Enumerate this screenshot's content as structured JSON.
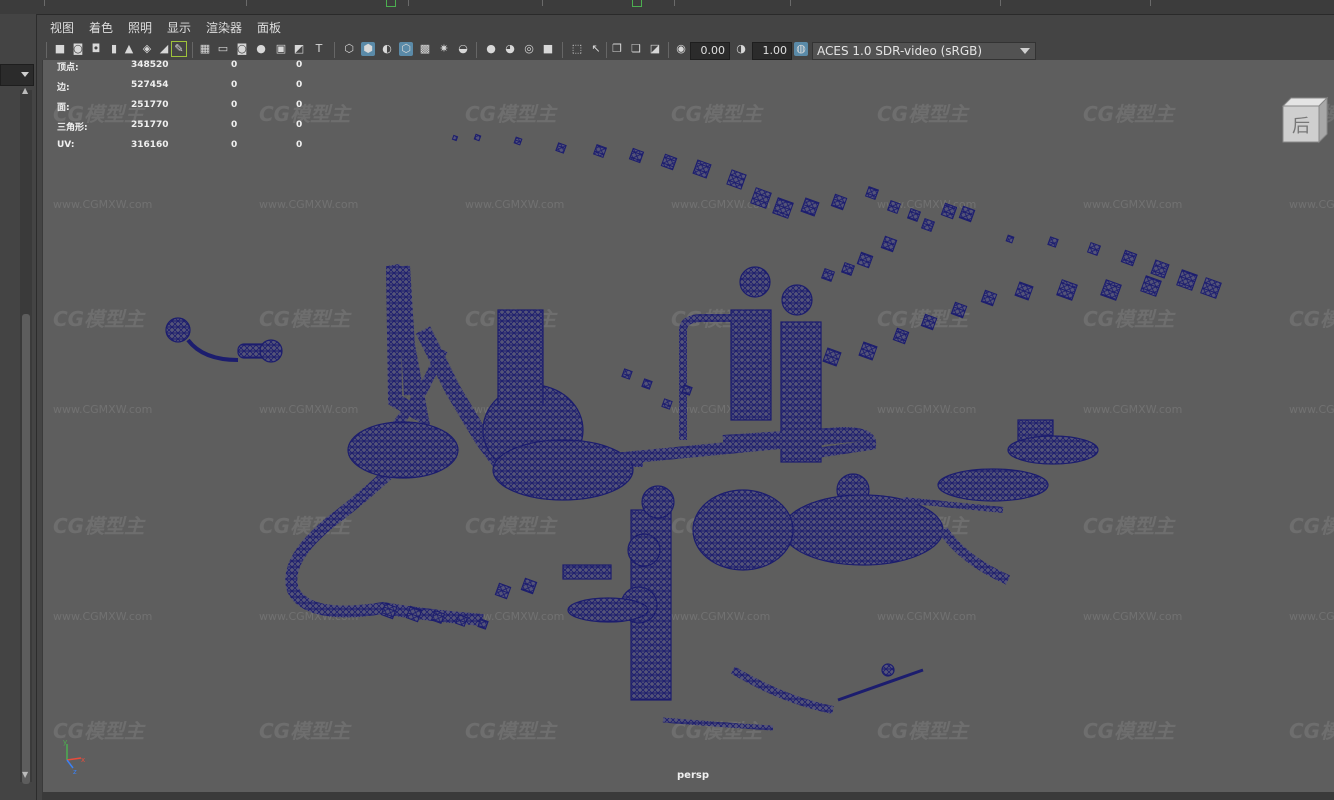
{
  "menu": {
    "items": [
      "视图",
      "着色",
      "照明",
      "显示",
      "渲染器",
      "面板"
    ]
  },
  "toolbar": {
    "icons": [
      "select-camera-icon",
      "camera-attributes-icon",
      "bookmark-icon",
      "image-plane-icon",
      "2d-pan-zoom-icon",
      "grease-pencil-icon",
      "grid-icon",
      "film-gate-icon",
      "resolution-gate-icon",
      "gate-mask-icon",
      "field-chart-icon",
      "safe-action-icon",
      "safe-title-icon",
      "wireframe-icon",
      "smooth-shade-icon",
      "default-material-icon",
      "wireframe-on-shaded-icon",
      "textured-icon",
      "use-all-lights-icon",
      "shadows-icon",
      "screen-space-ao-icon",
      "motion-blur-icon",
      "anti-aliasing-icon",
      "depth-of-field-icon",
      "isolate-select-icon",
      "xray-icon",
      "xray-active-icon",
      "xray-joints-icon",
      "backface-icon"
    ],
    "exposure_value": "0.00",
    "gamma_value": "1.00",
    "color_space": "ACES 1.0 SDR-video (sRGB)"
  },
  "hud": {
    "rows": [
      {
        "label": "顶点:",
        "v1": "348520",
        "v2": "0",
        "v3": "0"
      },
      {
        "label": "边:",
        "v1": "527454",
        "v2": "0",
        "v3": "0"
      },
      {
        "label": "面:",
        "v1": "251770",
        "v2": "0",
        "v3": "0"
      },
      {
        "label": "三角形:",
        "v1": "251770",
        "v2": "0",
        "v3": "0"
      },
      {
        "label": "UV:",
        "v1": "316160",
        "v2": "0",
        "v3": "0"
      }
    ]
  },
  "viewport": {
    "camera": "persp",
    "viewcube_label": "后",
    "background": "#5e5e5e",
    "wire_color": "#1c1d6e",
    "watermark_logo": "CG模型主",
    "watermark_url": "www.CGMXW.com"
  },
  "axis": {
    "x": "x",
    "y": "y",
    "z": "z"
  }
}
